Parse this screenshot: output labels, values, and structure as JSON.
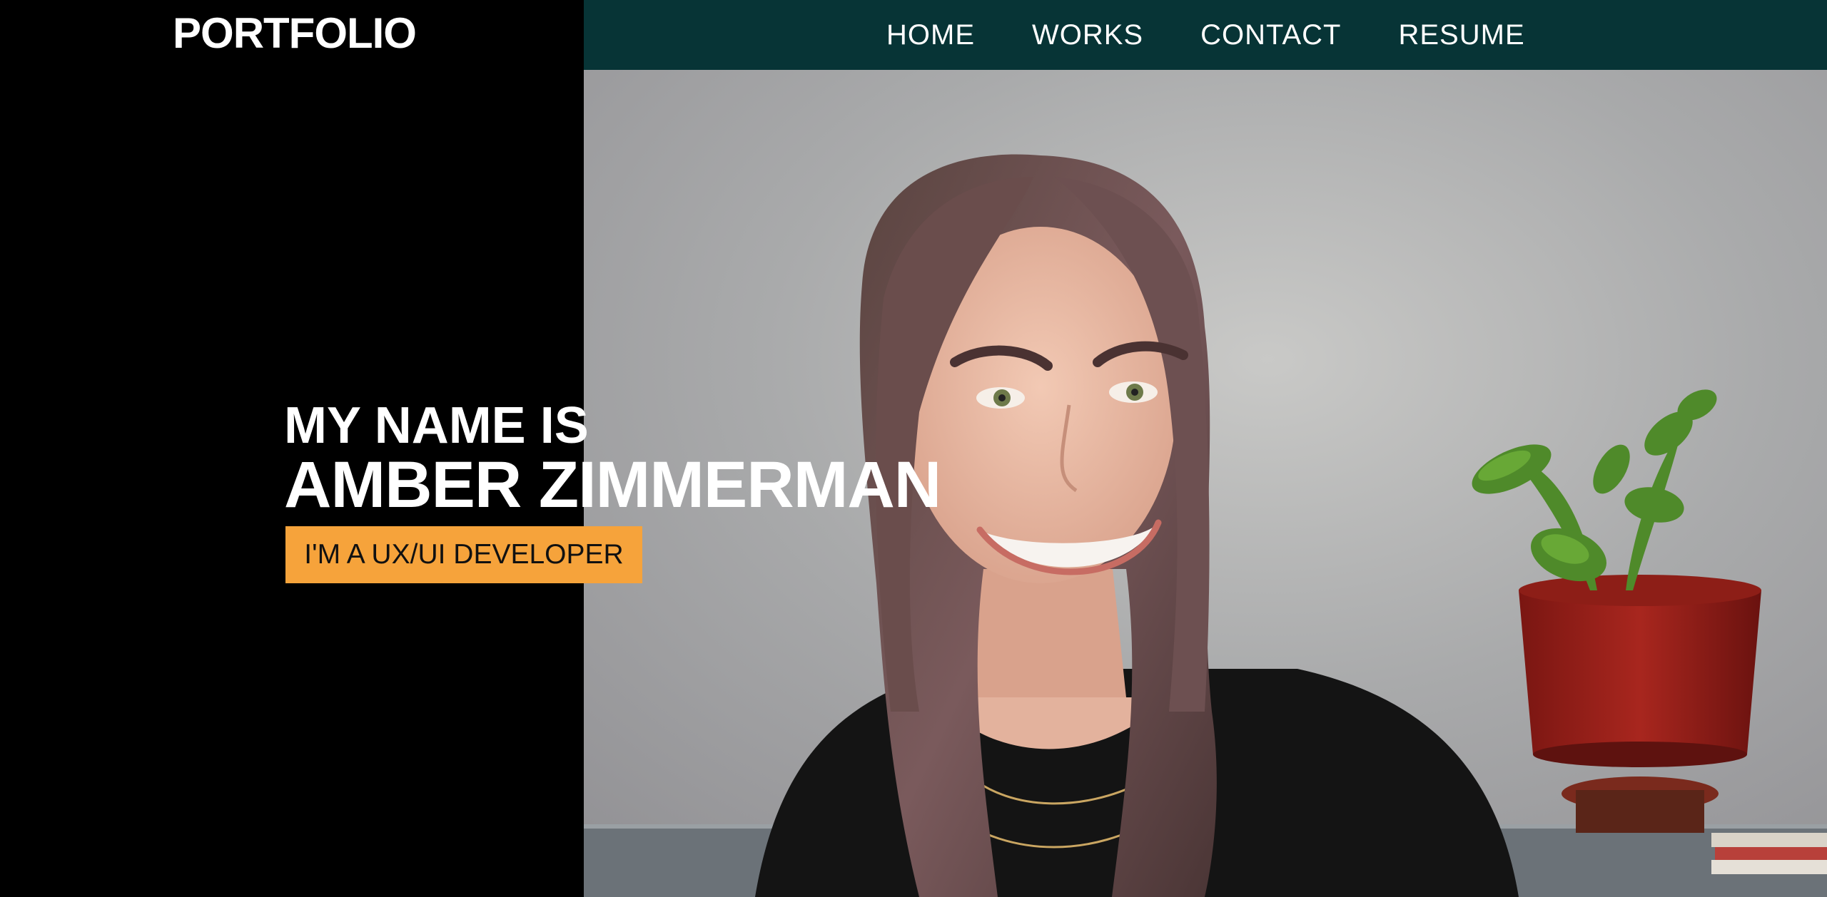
{
  "header": {
    "logo": "PORTFOLIO",
    "nav": [
      {
        "label": "HOME"
      },
      {
        "label": "WORKS"
      },
      {
        "label": "CONTACT"
      },
      {
        "label": "RESUME"
      }
    ]
  },
  "hero": {
    "intro": "MY NAME IS",
    "name": "AMBER ZIMMERMAN",
    "role": "I'M A UX/UI DEVELOPER"
  },
  "colors": {
    "topbar": "#073436",
    "accent": "#f6a33b",
    "left_panel": "#000000"
  }
}
